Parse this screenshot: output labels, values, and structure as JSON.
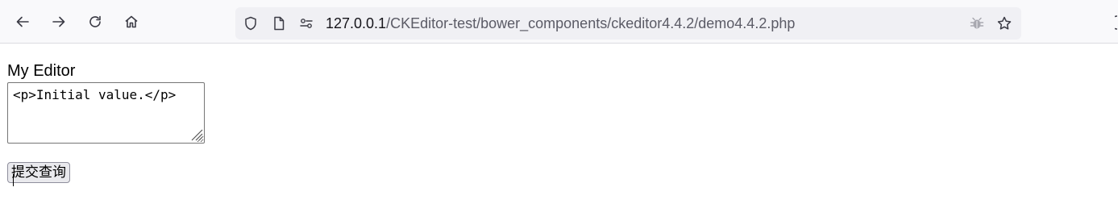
{
  "browser": {
    "nav": {
      "back_icon": "arrow-left-icon",
      "forward_icon": "arrow-right-icon",
      "reload_icon": "reload-icon",
      "home_icon": "home-icon"
    },
    "urlbar": {
      "host": "127.0.0.1",
      "path": "/CKEditor-test/bower_components/ckeditor4.4.2/demo4.4.2.php",
      "icons": [
        "shield-icon",
        "page-icon",
        "permissions-icon",
        "bug-icon",
        "star-icon"
      ]
    }
  },
  "form": {
    "label": "My Editor",
    "editor_value": "<p>Initial value.</p>",
    "submit_label": "提交查询"
  },
  "colors": {
    "toolbar_bg": "#f9f9fb",
    "urlbar_bg": "#f0f0f4",
    "url_host": "#15141a",
    "url_path": "#5b5b66",
    "icon": "#5b5b66"
  }
}
